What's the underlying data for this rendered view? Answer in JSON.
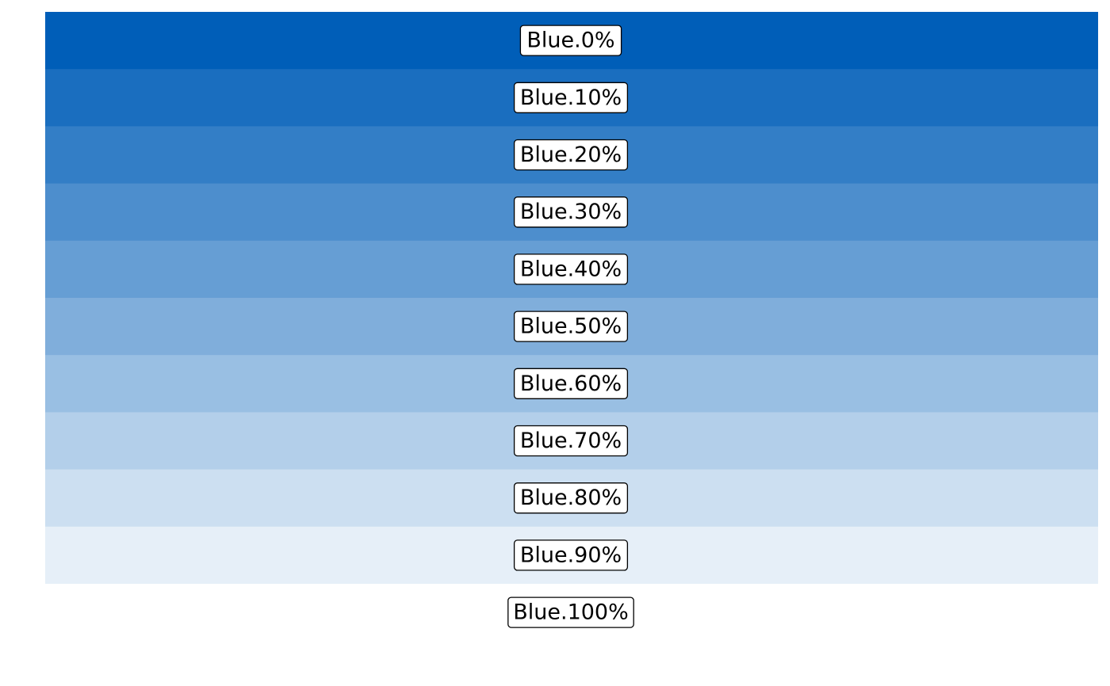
{
  "chart_data": {
    "type": "table",
    "title": "",
    "xlabel": "",
    "ylabel": "",
    "grid": false,
    "legend": "none",
    "swatches": [
      {
        "label": "Blue.0%",
        "tint_percent": 0,
        "color": "#005EB8"
      },
      {
        "label": "Blue.10%",
        "tint_percent": 10,
        "color": "#1A6EBF"
      },
      {
        "label": "Blue.20%",
        "tint_percent": 20,
        "color": "#337EC6"
      },
      {
        "label": "Blue.30%",
        "tint_percent": 30,
        "color": "#4D8ECD"
      },
      {
        "label": "Blue.40%",
        "tint_percent": 40,
        "color": "#669ED4"
      },
      {
        "label": "Blue.50%",
        "tint_percent": 50,
        "color": "#80AEDB"
      },
      {
        "label": "Blue.60%",
        "tint_percent": 60,
        "color": "#99BFE3"
      },
      {
        "label": "Blue.70%",
        "tint_percent": 70,
        "color": "#B3CFEA"
      },
      {
        "label": "Blue.80%",
        "tint_percent": 80,
        "color": "#CCDFF1"
      },
      {
        "label": "Blue.90%",
        "tint_percent": 90,
        "color": "#E6EFF8"
      },
      {
        "label": "Blue.100%",
        "tint_percent": 100,
        "color": "#FFFFFF"
      }
    ]
  },
  "colors": {
    "label_box_fill": "#FFFFFF",
    "label_box_border": "#000000",
    "background": "#FFFFFF"
  }
}
